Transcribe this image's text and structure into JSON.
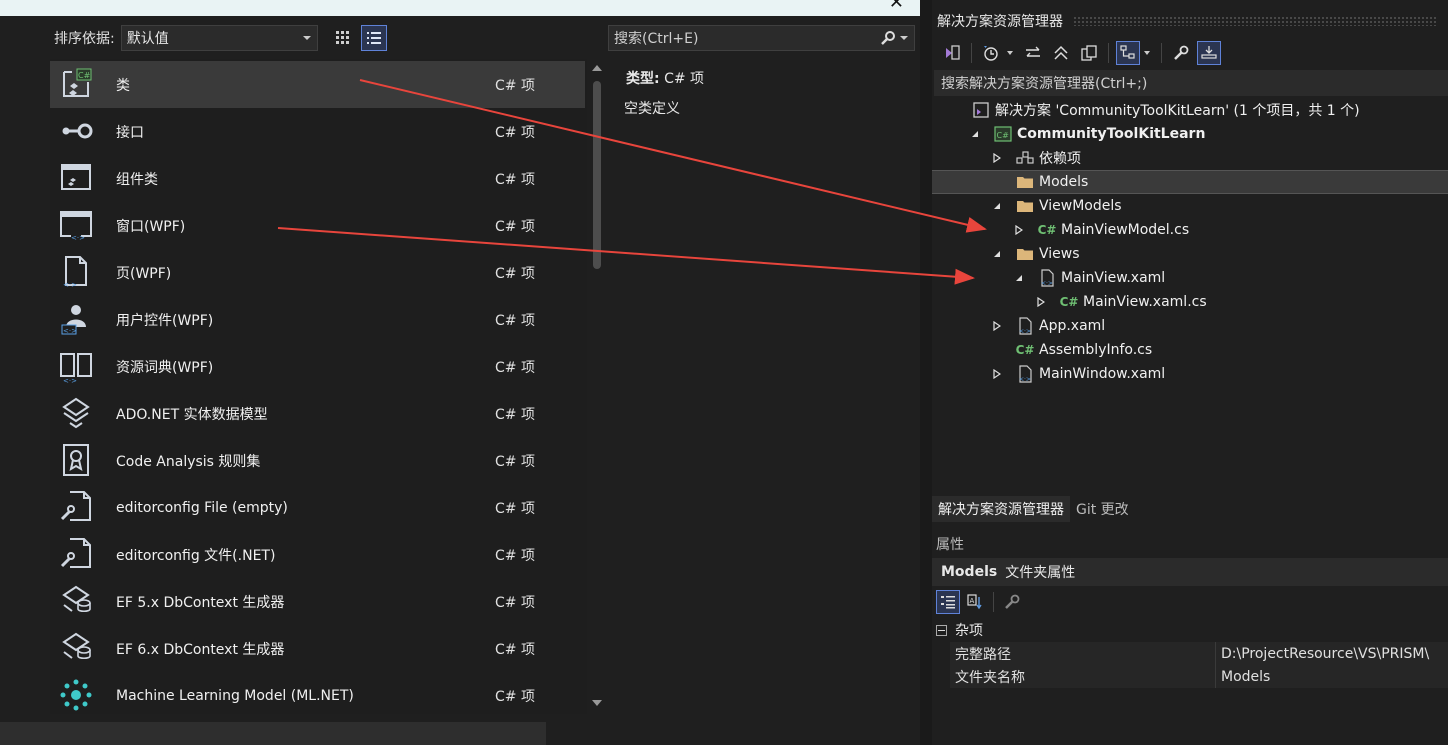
{
  "dialog": {
    "sort_label": "排序依据:",
    "sort_value": "默认值",
    "search_placeholder": "搜索(Ctrl+E)",
    "items": [
      {
        "name": "类",
        "type": "C# 项",
        "icon": "class-icon"
      },
      {
        "name": "接口",
        "type": "C# 项",
        "icon": "interface-icon"
      },
      {
        "name": "组件类",
        "type": "C# 项",
        "icon": "component-class-icon"
      },
      {
        "name": "窗口(WPF)",
        "type": "C# 项",
        "icon": "window-icon"
      },
      {
        "name": "页(WPF)",
        "type": "C# 项",
        "icon": "page-icon"
      },
      {
        "name": "用户控件(WPF)",
        "type": "C# 项",
        "icon": "user-control-icon"
      },
      {
        "name": "资源词典(WPF)",
        "type": "C# 项",
        "icon": "resource-dictionary-icon"
      },
      {
        "name": "ADO.NET 实体数据模型",
        "type": "C# 项",
        "icon": "entity-model-icon"
      },
      {
        "name": "Code Analysis 规则集",
        "type": "C# 项",
        "icon": "ruleset-icon"
      },
      {
        "name": "editorconfig File (empty)",
        "type": "C# 项",
        "icon": "editorconfig-icon"
      },
      {
        "name": "editorconfig 文件(.NET)",
        "type": "C# 项",
        "icon": "editorconfig-icon"
      },
      {
        "name": "EF 5.x DbContext 生成器",
        "type": "C# 项",
        "icon": "dbcontext-generator-icon"
      },
      {
        "name": "EF 6.x DbContext 生成器",
        "type": "C# 项",
        "icon": "dbcontext-generator-icon"
      },
      {
        "name": "Machine Learning Model (ML.NET)",
        "type": "C# 项",
        "icon": "ml-model-icon"
      }
    ],
    "description": {
      "type_label": "类型:",
      "type_value": "C# 项",
      "text": "空类定义"
    }
  },
  "solution_explorer": {
    "title": "解决方案资源管理器",
    "search_placeholder": "搜索解决方案资源管理器(Ctrl+;)",
    "tree": [
      {
        "label": "解决方案 'CommunityToolKitLearn' (1 个项目，共 1 个)",
        "icon": "solution-icon",
        "depth": 0,
        "expander": "none"
      },
      {
        "label": "CommunityToolKitLearn",
        "icon": "csharp-project-icon",
        "depth": 1,
        "expander": "expanded",
        "bold": true
      },
      {
        "label": "依赖项",
        "icon": "dependencies-icon",
        "depth": 2,
        "expander": "collapsed"
      },
      {
        "label": "Models",
        "icon": "folder-icon",
        "depth": 2,
        "expander": "none",
        "selected": true
      },
      {
        "label": "ViewModels",
        "icon": "folder-icon",
        "depth": 2,
        "expander": "expanded"
      },
      {
        "label": "MainViewModel.cs",
        "icon": "csharp-file-icon",
        "depth": 3,
        "expander": "collapsed"
      },
      {
        "label": "Views",
        "icon": "folder-icon",
        "depth": 2,
        "expander": "expanded"
      },
      {
        "label": "MainView.xaml",
        "icon": "xaml-file-icon",
        "depth": 3,
        "expander": "expanded"
      },
      {
        "label": "MainView.xaml.cs",
        "icon": "csharp-file-icon",
        "depth": 4,
        "expander": "collapsed"
      },
      {
        "label": "App.xaml",
        "icon": "xaml-file-icon",
        "depth": 2,
        "expander": "collapsed"
      },
      {
        "label": "AssemblyInfo.cs",
        "icon": "csharp-file-icon",
        "depth": 2,
        "expander": "none"
      },
      {
        "label": "MainWindow.xaml",
        "icon": "xaml-file-icon",
        "depth": 2,
        "expander": "collapsed"
      }
    ],
    "tabs": [
      "解决方案资源管理器",
      "Git 更改"
    ]
  },
  "properties": {
    "title": "属性",
    "object_name": "Models",
    "object_type": "文件夹属性",
    "category": "杂项",
    "rows": [
      {
        "key": "完整路径",
        "value": "D:\\ProjectResource\\VS\\PRISM\\"
      },
      {
        "key": "文件夹名称",
        "value": "Models"
      }
    ]
  },
  "colors": {
    "accent": "#5f82d8",
    "annotation_arrow": "#e8453c",
    "csharp_green": "#5cb85c",
    "folder_yellow": "#dcb67a"
  }
}
